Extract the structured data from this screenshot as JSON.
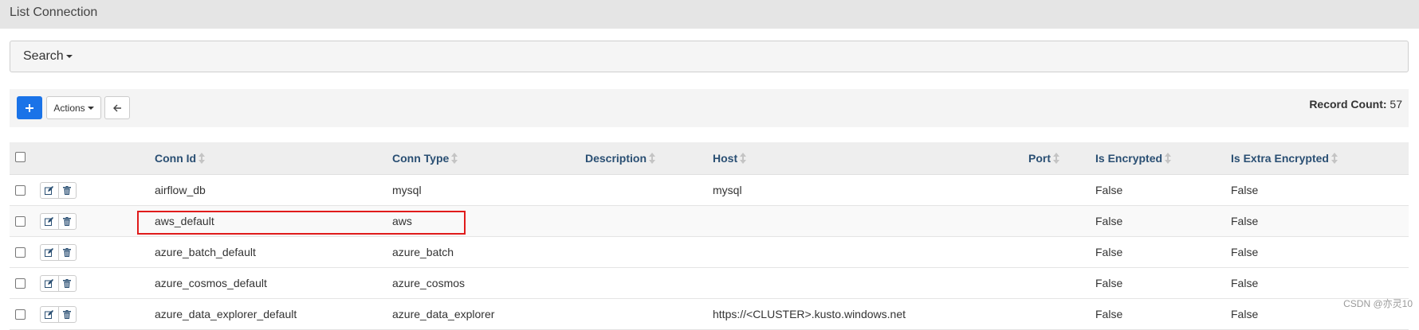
{
  "page": {
    "title": "List Connection"
  },
  "search": {
    "label": "Search"
  },
  "toolbar": {
    "add_icon": "plus-icon",
    "actions_label": "Actions",
    "back_icon": "arrow-left-icon",
    "record_count_label": "Record Count:",
    "record_count_value": "57"
  },
  "table": {
    "columns": [
      "Conn Id",
      "Conn Type",
      "Description",
      "Host",
      "Port",
      "Is Encrypted",
      "Is Extra Encrypted"
    ],
    "rows": [
      {
        "conn_id": "airflow_db",
        "conn_type": "mysql",
        "description": "",
        "host": "mysql",
        "port": "",
        "is_encrypted": "False",
        "is_extra_encrypted": "False"
      },
      {
        "conn_id": "aws_default",
        "conn_type": "aws",
        "description": "",
        "host": "",
        "port": "",
        "is_encrypted": "False",
        "is_extra_encrypted": "False"
      },
      {
        "conn_id": "azure_batch_default",
        "conn_type": "azure_batch",
        "description": "",
        "host": "",
        "port": "",
        "is_encrypted": "False",
        "is_extra_encrypted": "False"
      },
      {
        "conn_id": "azure_cosmos_default",
        "conn_type": "azure_cosmos",
        "description": "",
        "host": "",
        "port": "",
        "is_encrypted": "False",
        "is_extra_encrypted": "False"
      },
      {
        "conn_id": "azure_data_explorer_default",
        "conn_type": "azure_data_explorer",
        "description": "",
        "host": "https://<CLUSTER>.kusto.windows.net",
        "port": "",
        "is_encrypted": "False",
        "is_extra_encrypted": "False"
      }
    ]
  },
  "watermark": "CSDN @亦灵10",
  "colors": {
    "accent": "#1a73e8",
    "header_text": "#2a4f73",
    "highlight": "#e01b1b"
  }
}
